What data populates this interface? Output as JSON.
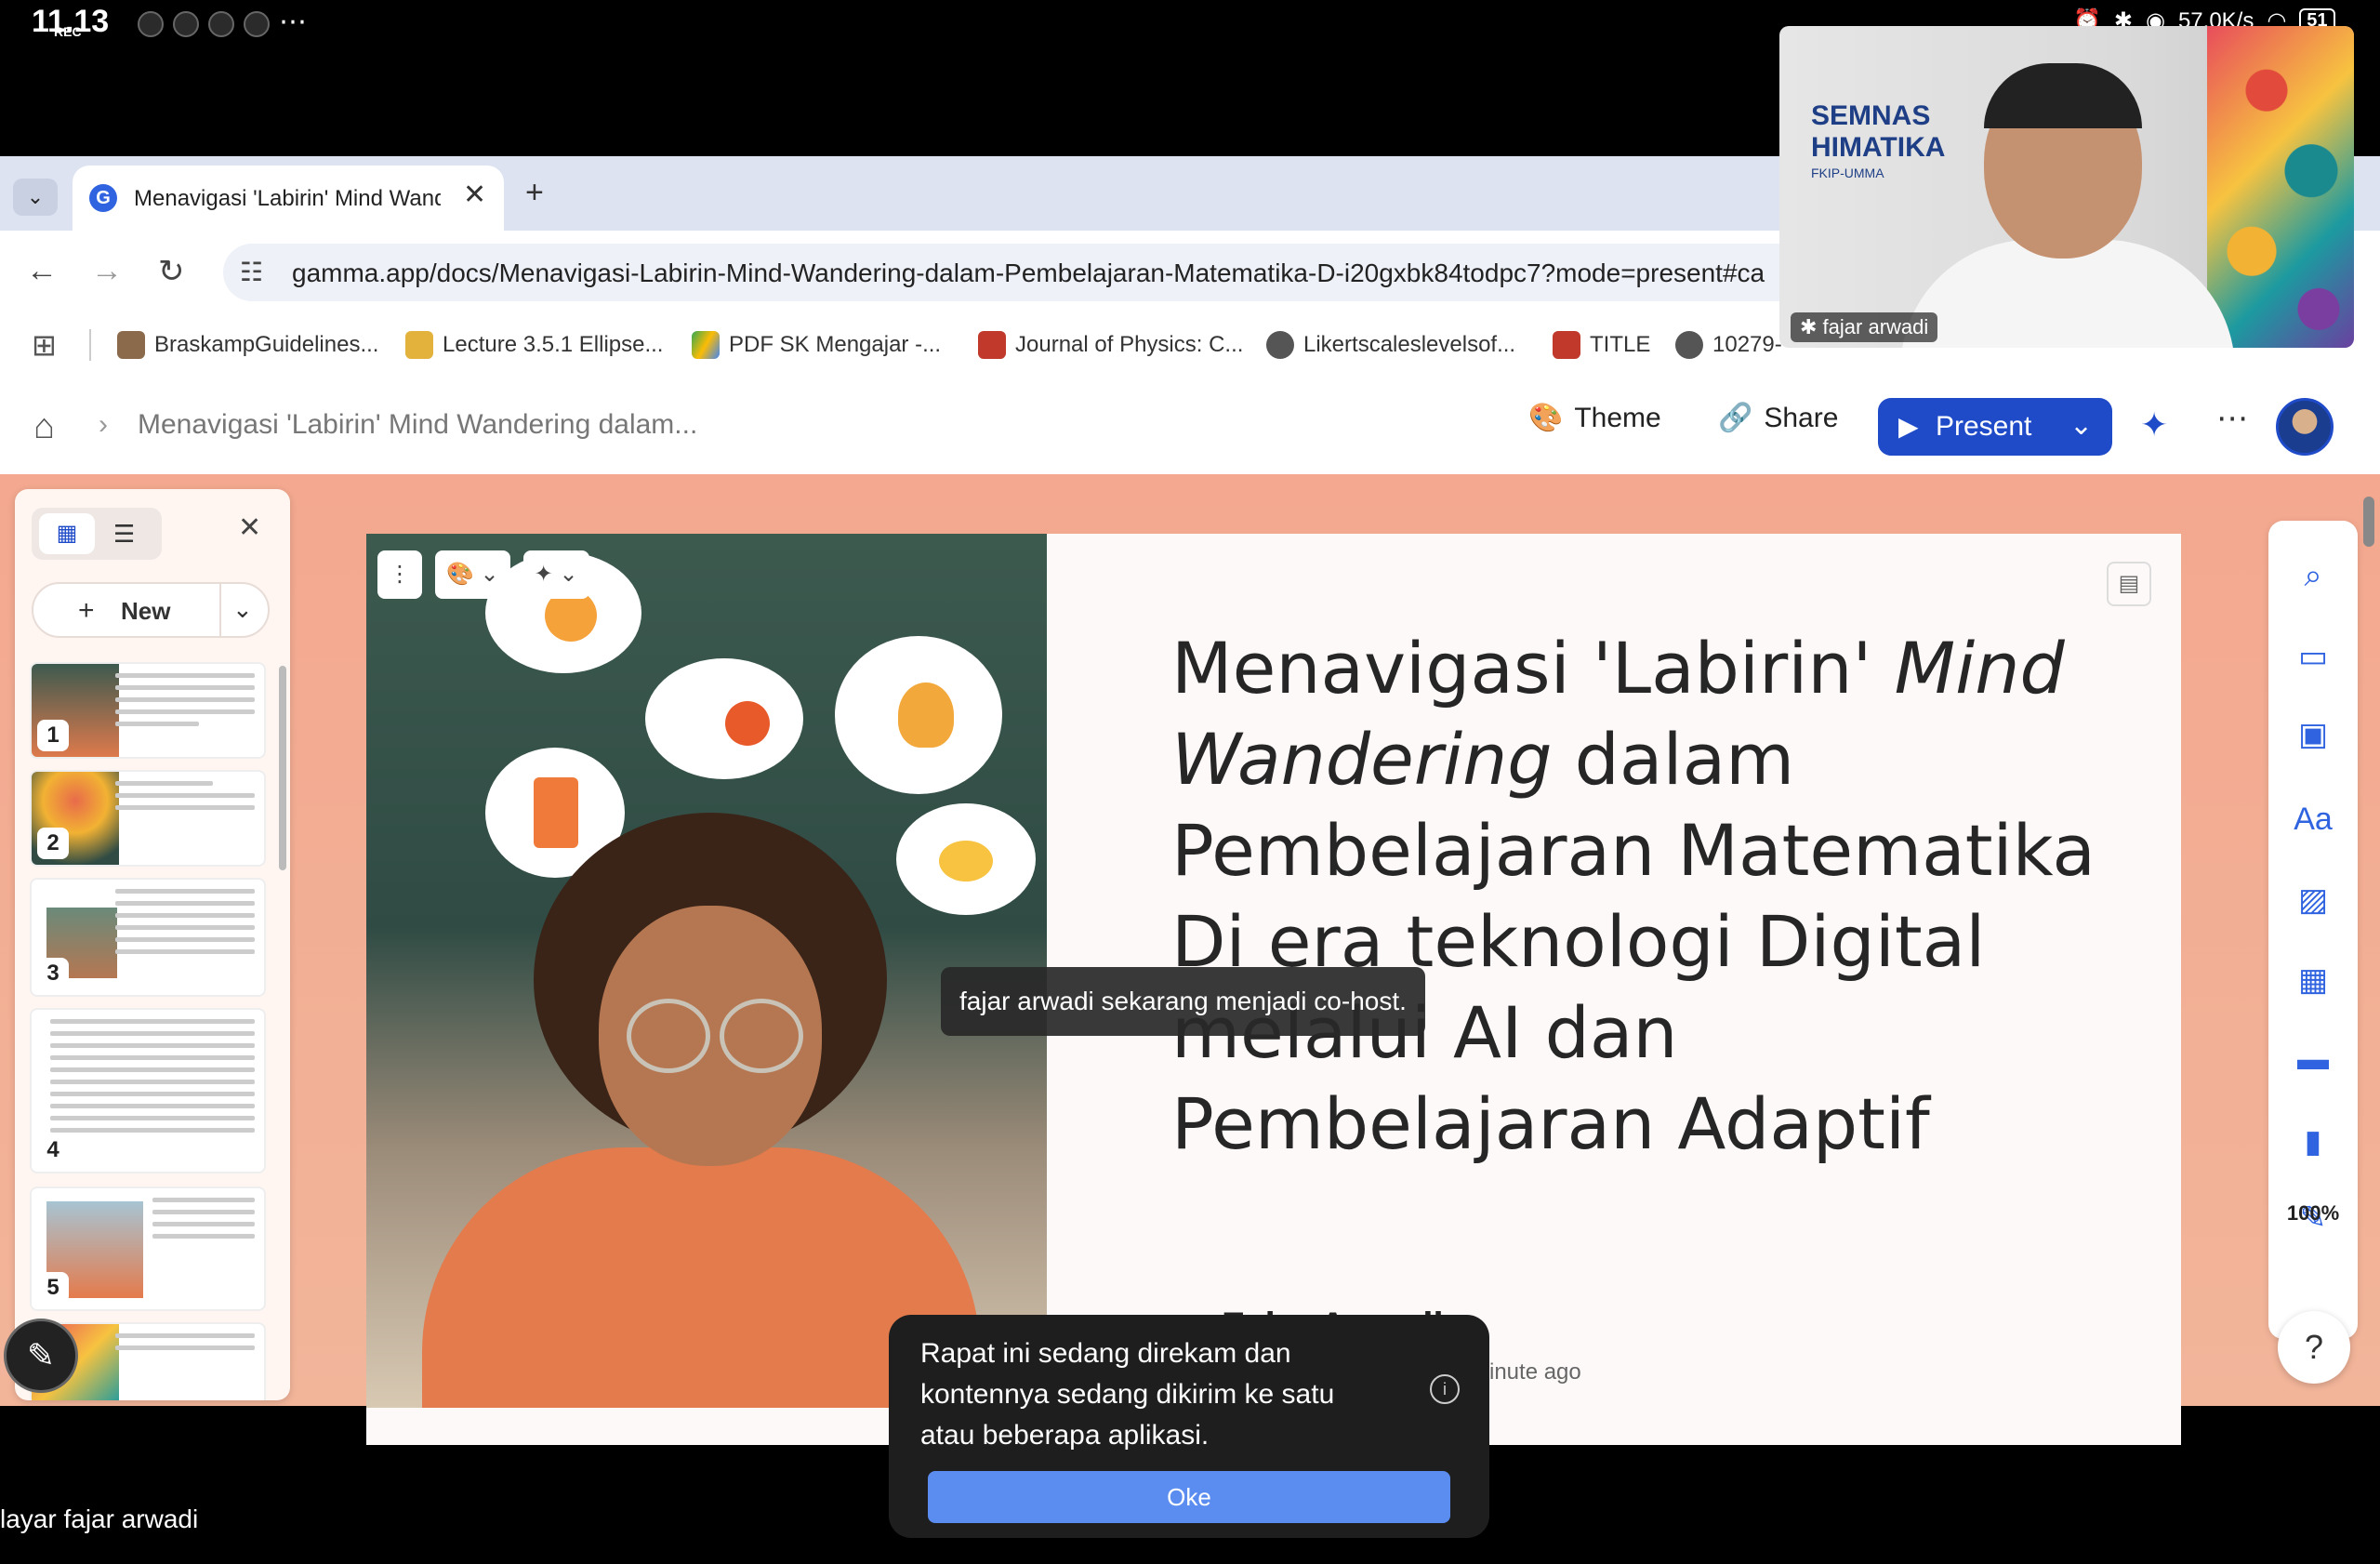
{
  "status_bar": {
    "time": "11.13",
    "rec": "REC",
    "network_speed": "57,0K/s",
    "battery": "51"
  },
  "browser": {
    "tab_title": "Menavigasi 'Labirin' Mind Wandering dalam Pembelajaran Matematika",
    "url": "gamma.app/docs/Menavigasi-Labirin-Mind-Wandering-dalam-Pembelajaran-Matematika-D-i20gxbk84todpc7?mode=present#ca",
    "bookmarks": [
      "BraskampGuidelines...",
      "Lecture 3.5.1 Ellipse...",
      "PDF SK Mengajar -...",
      "Journal of Physics: C...",
      "Likertscaleslevelsof...",
      "TITLE",
      "10279-"
    ]
  },
  "header": {
    "doc_title": "Menavigasi 'Labirin' Mind Wandering dalam...",
    "theme_label": "Theme",
    "share_label": "Share",
    "present_label": "Present"
  },
  "sidebar": {
    "new_label": "New",
    "slides": [
      "1",
      "2",
      "3",
      "4",
      "5"
    ]
  },
  "slide": {
    "title_part1": "Menavigasi 'Labirin' ",
    "title_italic1": "Mind Wandering",
    "title_part2": " dalam Pembelajaran Matematika Di era teknologi Digital melalui AI dan Pembelajaran Adaptif",
    "author": "Fajar Arwadi",
    "edited": "inute ago"
  },
  "right_toolbar": {
    "zoom": "100%"
  },
  "toast": "fajar arwadi sekarang menjadi co-host.",
  "video": {
    "banner_line1": "SEMNAS",
    "banner_line2": "HIMATIKA",
    "banner_line3": "FKIP-UMMA",
    "participant": "fajar arwadi"
  },
  "dialog": {
    "message": "Rapat ini sedang direkam dan kontennya sedang dikirim ke satu atau beberapa aplikasi.",
    "ok_label": "Oke"
  },
  "screen_owner": "layar fajar arwadi"
}
